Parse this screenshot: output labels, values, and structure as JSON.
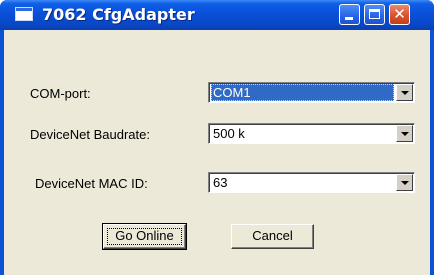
{
  "window": {
    "title": "7062 CfgAdapter"
  },
  "fields": [
    {
      "label": "COM-port:",
      "value": "COM1"
    },
    {
      "label": "DeviceNet Baudrate:",
      "value": "500 k"
    },
    {
      "label": "DeviceNet MAC ID:",
      "value": "63"
    }
  ],
  "buttons": {
    "go_online": "Go Online",
    "cancel": "Cancel"
  },
  "icons": {
    "app": "window-app-icon",
    "minimize": "minimize-icon",
    "maximize": "maximize-icon",
    "close": "close-icon",
    "dropdown": "chevron-down-icon"
  },
  "colors": {
    "titlebar": "#0a4fd8",
    "client": "#ece9d8",
    "selection": "#316ac5",
    "close_button": "#d9532d"
  }
}
